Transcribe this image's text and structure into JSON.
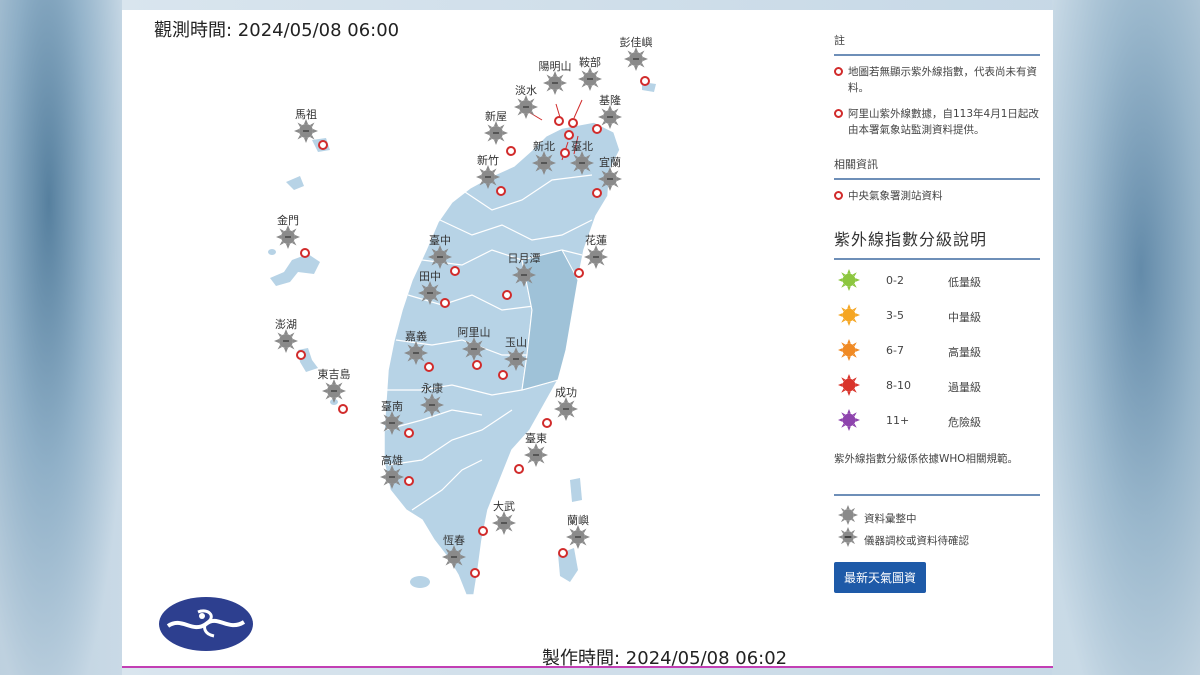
{
  "observation_time": "觀測時間: 2024/05/08 06:00",
  "production_time": "製作時間: 2024/05/08 06:02",
  "stations": [
    {
      "name": "彭佳嶼"
    },
    {
      "name": "陽明山"
    },
    {
      "name": "鞍部"
    },
    {
      "name": "淡水"
    },
    {
      "name": "基隆"
    },
    {
      "name": "新屋"
    },
    {
      "name": "新北"
    },
    {
      "name": "臺北"
    },
    {
      "name": "新竹"
    },
    {
      "name": "宜蘭"
    },
    {
      "name": "馬祖"
    },
    {
      "name": "金門"
    },
    {
      "name": "臺中"
    },
    {
      "name": "花蓮"
    },
    {
      "name": "日月潭"
    },
    {
      "name": "田中"
    },
    {
      "name": "澎湖"
    },
    {
      "name": "嘉義"
    },
    {
      "name": "阿里山"
    },
    {
      "name": "玉山"
    },
    {
      "name": "東吉島"
    },
    {
      "name": "永康"
    },
    {
      "name": "成功"
    },
    {
      "name": "臺南"
    },
    {
      "name": "臺東"
    },
    {
      "name": "高雄"
    },
    {
      "name": "大武"
    },
    {
      "name": "蘭嶼"
    },
    {
      "name": "恆春"
    }
  ],
  "sidebar": {
    "notes_title": "註",
    "notes": [
      "地圖若無顯示紫外線指數，代表尚未有資料。",
      "阿里山紫外線數據，自113年4月1日起改由本署氣象站監測資料提供。"
    ],
    "related_title": "相關資訊",
    "related_link": "中央氣象署測站資料",
    "uv_title": "紫外線指數分級說明",
    "uv_levels": [
      {
        "range": "0-2",
        "level": "低量級",
        "color": "#8cc63f"
      },
      {
        "range": "3-5",
        "level": "中量級",
        "color": "#f5a623"
      },
      {
        "range": "6-7",
        "level": "高量級",
        "color": "#f08a24"
      },
      {
        "range": "8-10",
        "level": "過量級",
        "color": "#d9342b"
      },
      {
        "range": "11+",
        "level": "危險級",
        "color": "#8e44ad"
      }
    ],
    "who_note": "紫外線指數分級係依據WHO相關規範。",
    "legend": [
      {
        "text": "資料彙整中",
        "icon": "sun-gray-icon"
      },
      {
        "text": "儀器調校或資料待確認",
        "icon": "sun-gray-dash-icon"
      }
    ],
    "button_label": "最新天氣圖資"
  },
  "colors": {
    "map_land": "#b7d3e6",
    "map_border": "#ffffff",
    "station_sun": "#8a8a8a",
    "dot": "#d12b2b",
    "accent": "#1e5aa8"
  }
}
